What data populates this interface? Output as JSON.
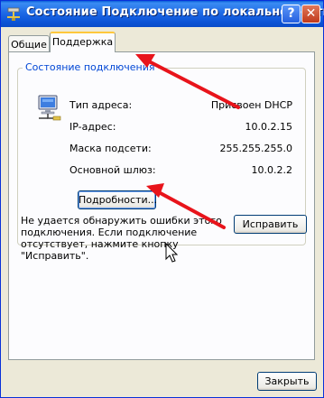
{
  "window": {
    "title": "Состояние Подключение по локальной сети",
    "help_label": "?",
    "close_label": "✕"
  },
  "tabs": [
    {
      "label": "Общие",
      "active": false
    },
    {
      "label": "Поддержка",
      "active": true
    }
  ],
  "group": {
    "title": "Состояние подключения",
    "rows": [
      {
        "label": "Тип адреса:",
        "value": "Присвоен DHCP"
      },
      {
        "label": "IP-адрес:",
        "value": "10.0.2.15"
      },
      {
        "label": "Маска подсети:",
        "value": "255.255.255.0"
      },
      {
        "label": "Основной шлюз:",
        "value": "10.0.2.2"
      }
    ],
    "details_label": "Подробности..."
  },
  "message": "Не удается обнаружить ошибки этого подключения. Если подключение отсутствует, нажмите кнопку \"Исправить\".",
  "repair_label": "Исправить",
  "close_button_label": "Закрыть",
  "colors": {
    "titlebar": "#0c54d7",
    "dialog_bg": "#ece9d8",
    "group_title": "#0046d5",
    "annotation_arrow": "#e8141b"
  },
  "icons": {
    "title": "network-connection-icon",
    "connection": "network-computer-icon",
    "cursor": "mouse-pointer-icon"
  }
}
